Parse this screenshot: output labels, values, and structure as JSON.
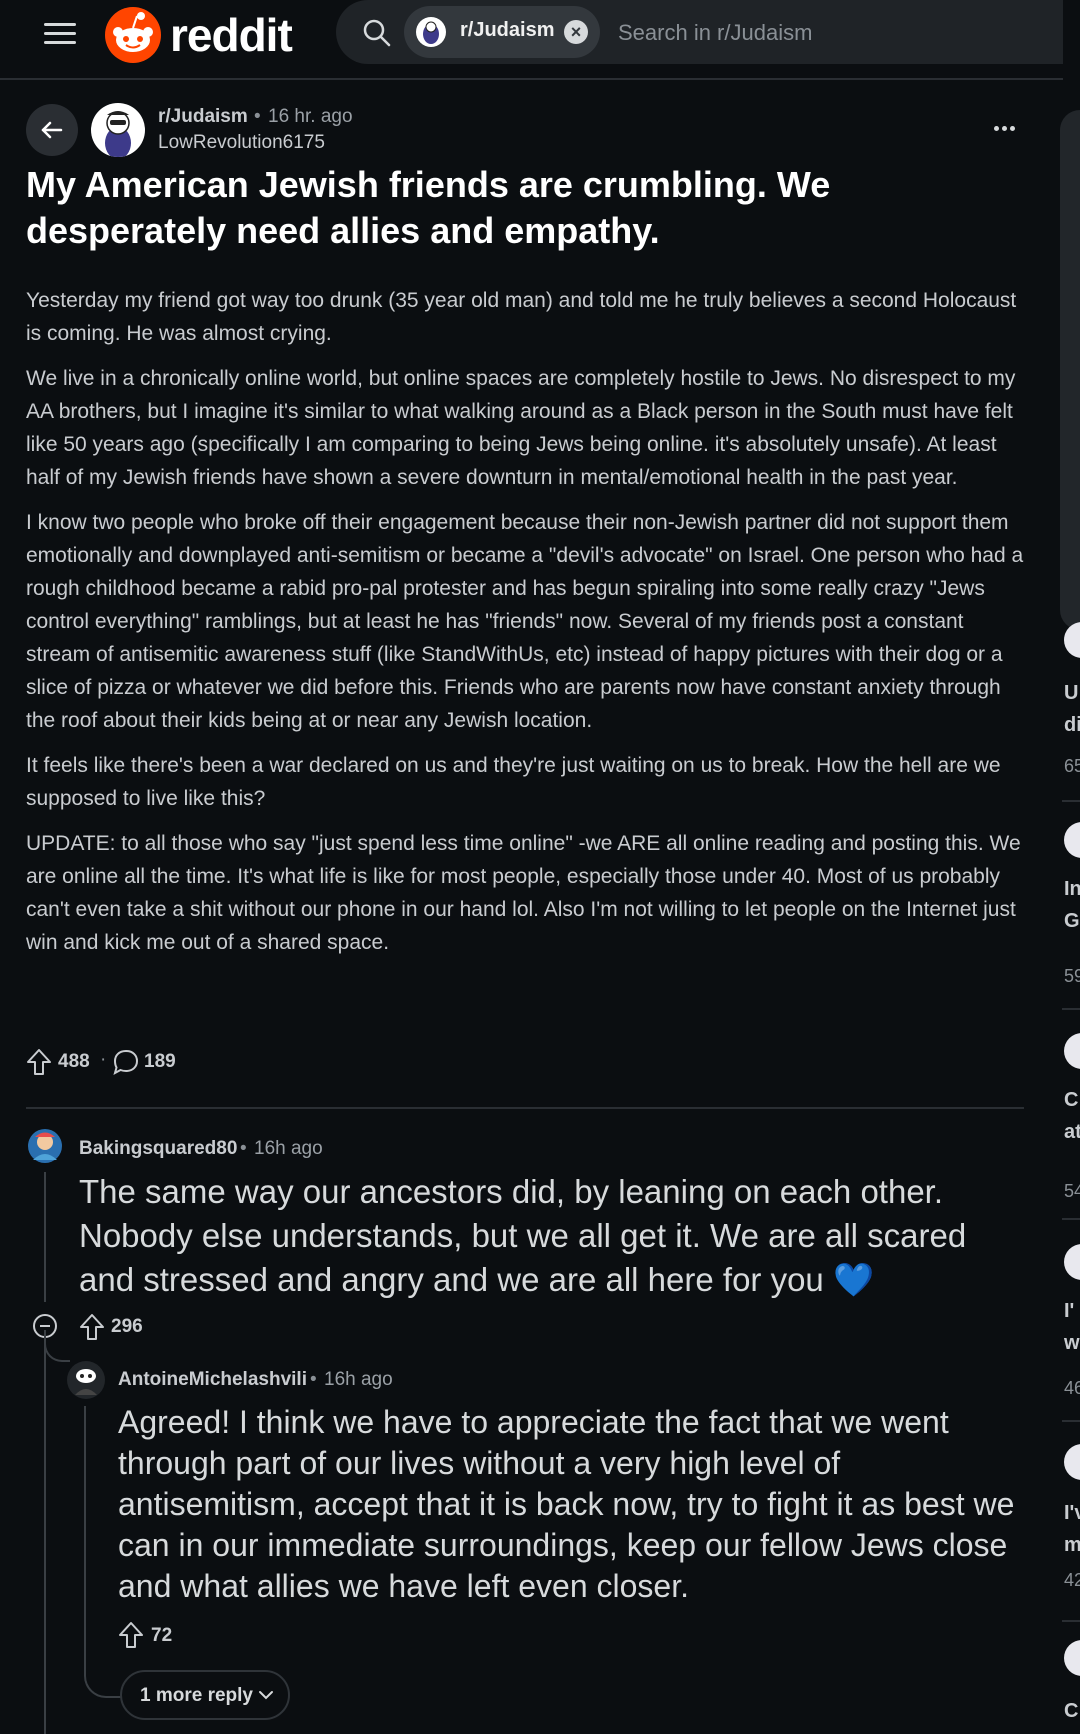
{
  "header": {
    "brand": "reddit",
    "search_chip": "r/Judaism",
    "search_placeholder": "Search in r/Judaism",
    "chip_close": "×"
  },
  "post": {
    "subreddit": "r/Judaism",
    "separator": "•",
    "time": "16 hr. ago",
    "author": "LowRevolution6175",
    "title": "My American Jewish friends are crumbling. We desperately need allies and empathy.",
    "paragraphs": [
      "Yesterday my friend got way too drunk (35 year old man) and told me he truly believes a second Holocaust is coming. He was almost crying.",
      "We live in a chronically online world, but online spaces are completely hostile to Jews. No disrespect to my AA brothers, but I imagine it's similar to what walking around as a Black person in the South must have felt like 50 years ago (specifically I am comparing to being Jews being online. it's absolutely unsafe). At least half of my Jewish friends have shown a severe downturn in mental/emotional health in the past year.",
      "I know two people who broke off their engagement because their non-Jewish partner did not support them emotionally and downplayed anti-semitism or became a \"devil's advocate\" on Israel. One person who had a rough childhood became a rabid pro-pal protester and has begun spiraling into some really crazy \"Jews control everything\" ramblings, but at least he has \"friends\" now. Several of my friends post a constant stream of antisemitic awareness stuff (like StandWithUs, etc) instead of happy pictures with their dog or a slice of pizza or whatever we did before this. Friends who are parents now have constant anxiety through the roof about their kids being at or near any Jewish location.",
      "It feels like there's been a war declared on us and they're just waiting on us to break. How the hell are we supposed to live like this?",
      "UPDATE: to all those who say \"just spend less time online\" -we ARE all online reading and posting this. We are online all the time. It's what life is like for most people, especially those under 40. Most of us probably can't even take a shit without our phone in our hand lol. Also I'm not willing to let people on the Internet just win and kick me out of a shared space."
    ],
    "upvotes": "488",
    "vote_separator": "·",
    "comments": "189"
  },
  "comments": [
    {
      "author": "Bakingsquared80",
      "separator": "•",
      "time": "16h ago",
      "text": "The same way our ancestors did, by leaning on each other. Nobody else understands, but we all get it. We are all scared and stressed and angry and we are all here for you 💙",
      "upvotes": "296"
    },
    {
      "author": "AntoineMichelashvili",
      "separator": "•",
      "time": "16h ago",
      "text": "Agreed! I think we have to appreciate the fact that we went through part of our lives without a very high level of antisemitism, accept that it is back now, try to fight it as best we can in our immediate surroundings, keep our fellow Jews close and what allies we have left even closer.",
      "upvotes": "72",
      "more_replies": "1 more reply"
    }
  ],
  "right_rail": [
    {
      "line1": "U",
      "line2": "di",
      "count": "65"
    },
    {
      "line1": "In",
      "line2": "G",
      "count": "59"
    },
    {
      "line1": "C",
      "line2": "at",
      "count": "54"
    },
    {
      "line1": "I'",
      "line2": "w",
      "count": "46"
    },
    {
      "line1": "I'v",
      "line2": "m",
      "count": "42"
    },
    {
      "line1": "C",
      "line2": "",
      "count": ""
    }
  ],
  "colors": {
    "background": "#0b0e11",
    "brand": "#ff4500",
    "heart": "#2f7fe0"
  }
}
